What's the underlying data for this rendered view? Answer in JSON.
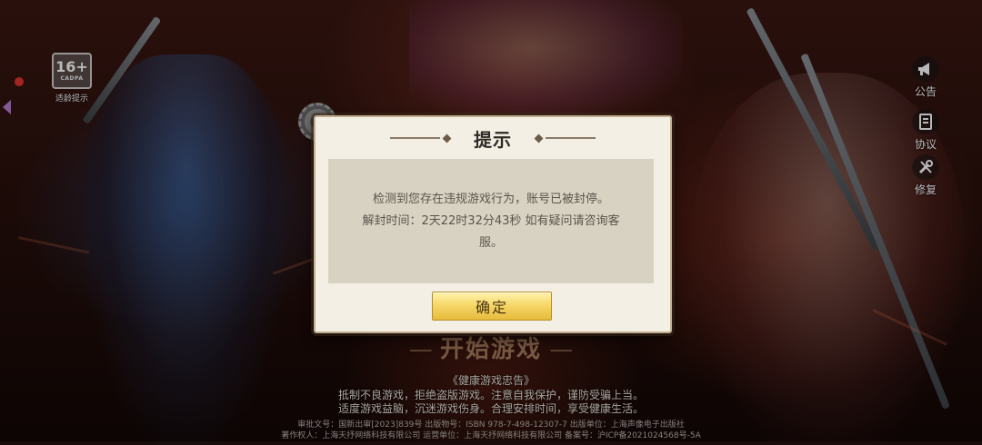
{
  "age_rating": {
    "value": "16+",
    "sub": "CADPA",
    "label": "适龄提示"
  },
  "side_buttons": [
    {
      "label": "公告",
      "icon": "megaphone-icon"
    },
    {
      "label": "协议",
      "icon": "document-icon"
    },
    {
      "label": "修复",
      "icon": "wrench-icon"
    }
  ],
  "dialog": {
    "title": "提示",
    "message_line1": "检测到您存在违规游戏行为，账号已被封停。",
    "message_line2": "解封时间：2天22时32分43秒 如有疑问请咨询客服。",
    "confirm_label": "确定"
  },
  "start_game": {
    "label": "开始游戏"
  },
  "health_notice": {
    "title": "《健康游戏忠告》",
    "line1": "抵制不良游戏，拒绝盗版游戏。注意自我保护，谨防受骗上当。",
    "line2": "适度游戏益脑，沉迷游戏伤身。合理安排时间，享受健康生活。"
  },
  "publication_info": {
    "line1": "审批文号：国新出审[2023]839号    出版物号：ISBN 978-7-498-12307-7    出版单位：上海声像电子出版社",
    "line2": "著作权人：上海天抒网络科技有限公司    运营单位：上海天抒网络科技有限公司    备案号：沪ICP备2021024568号-5A"
  },
  "colors": {
    "button_gold": "#f6d86a",
    "dialog_bg": "#f4efe4",
    "body_bg": "#d8d2c2"
  }
}
